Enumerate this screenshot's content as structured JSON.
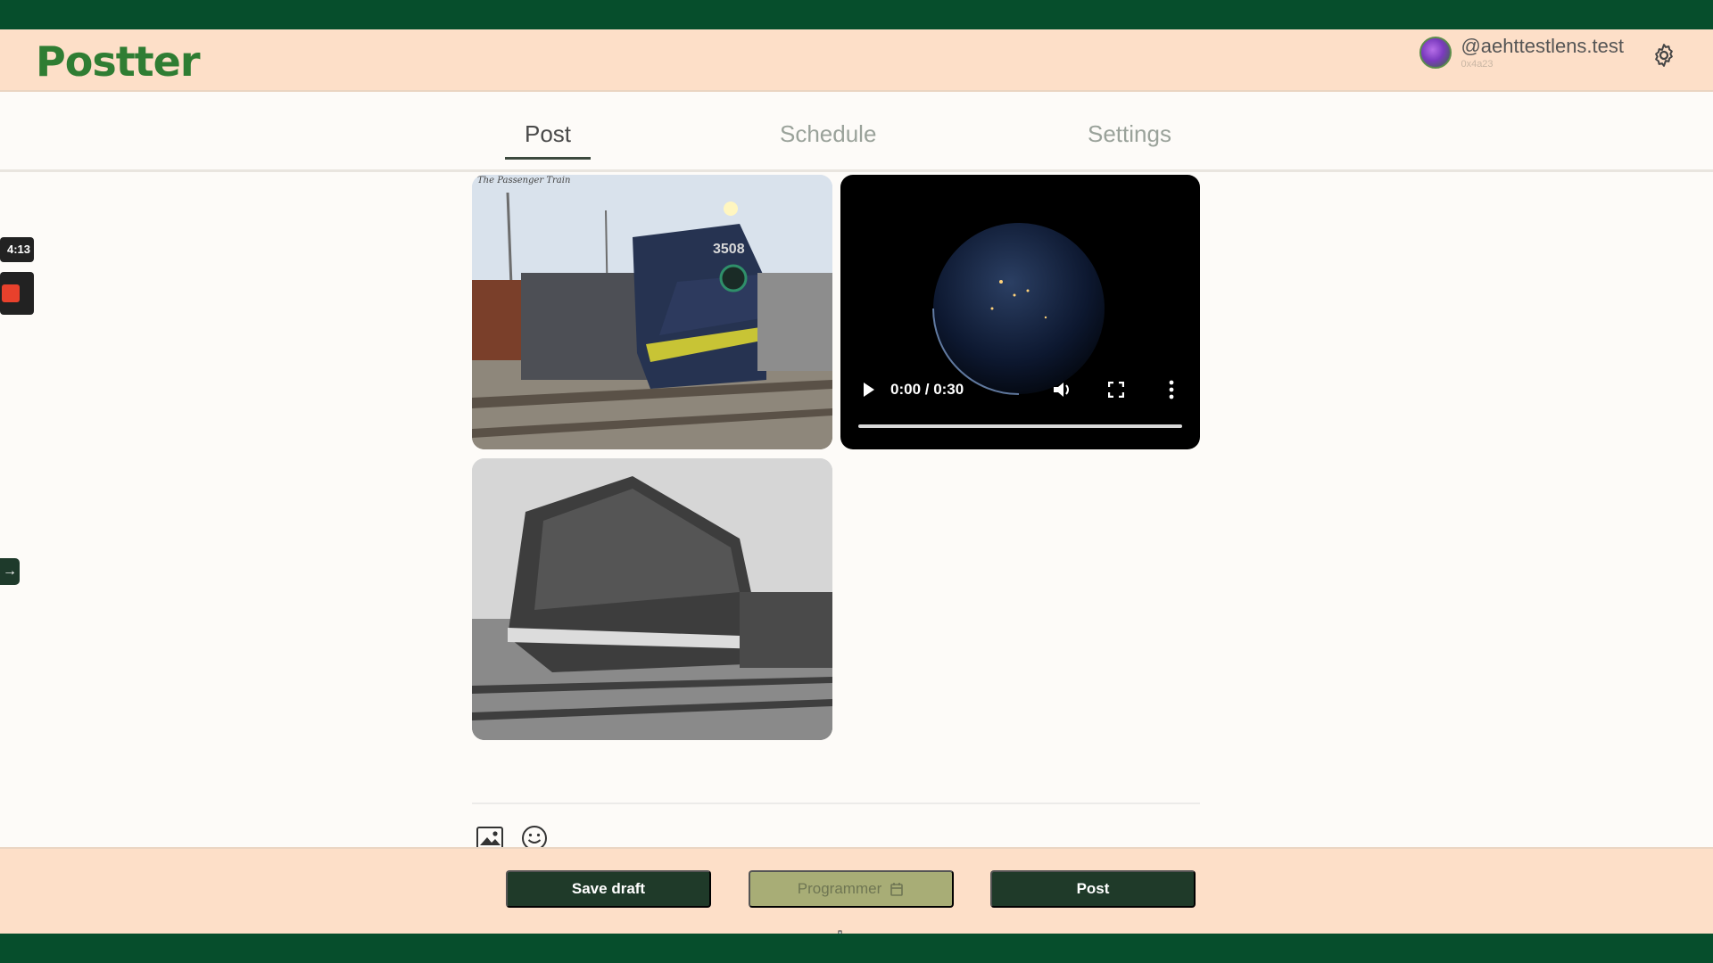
{
  "app": {
    "logo_text": "Postter",
    "user": {
      "handle": "@aehttestlens.test",
      "address": "0x4a23"
    }
  },
  "tabs": [
    {
      "label": "Post",
      "active": true
    },
    {
      "label": "Schedule",
      "active": false
    },
    {
      "label": "Settings",
      "active": false
    }
  ],
  "recording": {
    "timer": "4:13"
  },
  "media": {
    "image1": {
      "caption": "The Passenger Train",
      "badge": "3508"
    },
    "video": {
      "time": "0:00 / 0:30",
      "progress": 0
    },
    "image2": {}
  },
  "footer": {
    "save_label": "Save draft",
    "schedule_label": "Programmer",
    "post_label": "Post"
  },
  "colors": {
    "brand_dark": "#1f3a29",
    "header_bg": "#fddfc8",
    "accent": "#2f7d33"
  }
}
